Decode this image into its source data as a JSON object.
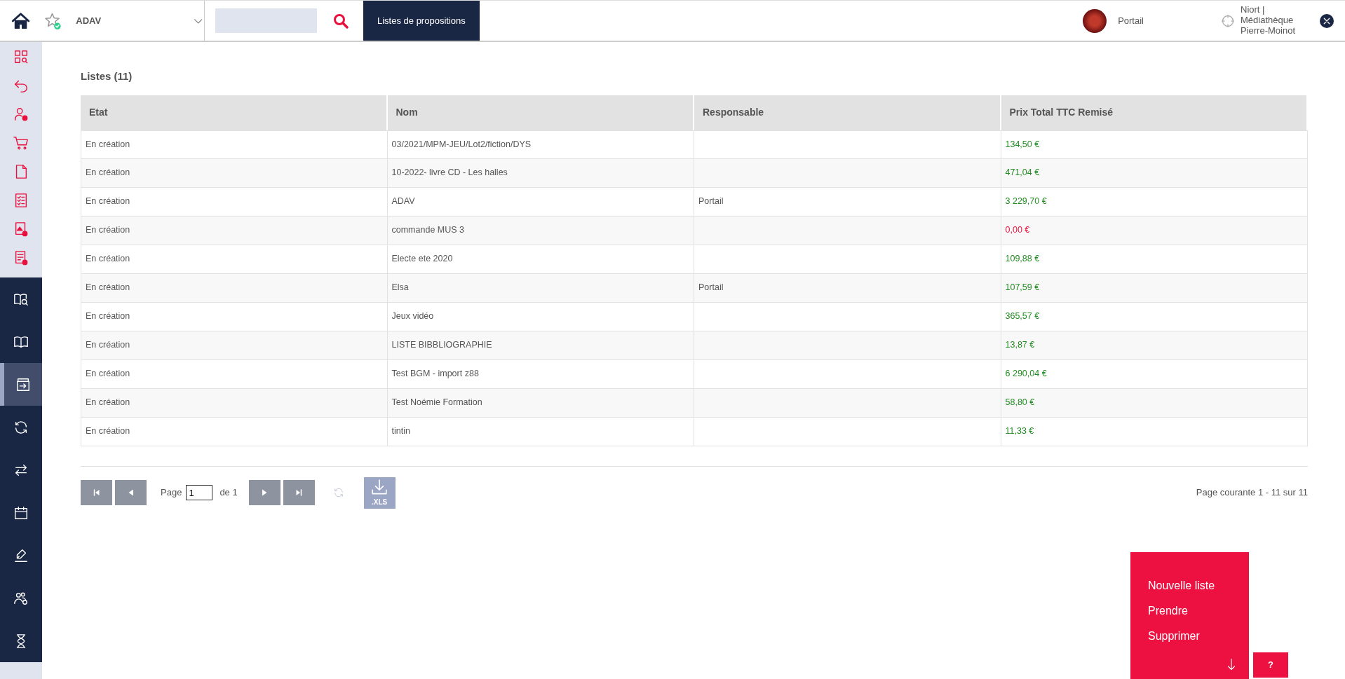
{
  "topbar": {
    "favorite": "ADAV",
    "tab": {
      "label": "Listes de propositions",
      "selected": true
    },
    "user": "Portail",
    "location": "Niort | Médiathèque Pierre-Moinot"
  },
  "sidebar": {
    "items": [
      {
        "kind": "light",
        "selected": false
      },
      {
        "kind": "light",
        "selected": false
      },
      {
        "kind": "light",
        "selected": false
      },
      {
        "kind": "light",
        "selected": false
      },
      {
        "kind": "light",
        "selected": false
      },
      {
        "kind": "light",
        "selected": false
      },
      {
        "kind": "light",
        "selected": false
      },
      {
        "kind": "light",
        "selected": false
      },
      {
        "kind": "dark",
        "selected": false
      },
      {
        "kind": "dark",
        "selected": false
      },
      {
        "kind": "dark",
        "selected": true
      },
      {
        "kind": "dark",
        "selected": false
      },
      {
        "kind": "dark",
        "selected": false
      },
      {
        "kind": "dark",
        "selected": false
      },
      {
        "kind": "dark",
        "selected": false
      },
      {
        "kind": "dark",
        "selected": false
      },
      {
        "kind": "dark",
        "selected": false
      }
    ]
  },
  "title": "Listes (11)",
  "table": {
    "columns": [
      "Etat",
      "Nom",
      "Responsable",
      "Prix Total TTC Remisé"
    ],
    "rows": [
      {
        "etat": "En création",
        "nom": "03/2021/MPM-JEU/Lot2/fiction/DYS",
        "responsable": "",
        "prix": "134,50 €",
        "color": "#218c21"
      },
      {
        "etat": "En création",
        "nom": "10-2022- livre CD - Les halles",
        "responsable": "",
        "prix": "471,04 €",
        "color": "#218c21"
      },
      {
        "etat": "En création",
        "nom": "ADAV",
        "responsable": "Portail",
        "prix": "3 229,70 €",
        "color": "#218c21"
      },
      {
        "etat": "En création",
        "nom": "commande MUS 3",
        "responsable": "",
        "prix": "0,00 €",
        "color": "#e8113d"
      },
      {
        "etat": "En création",
        "nom": "Electe ete 2020",
        "responsable": "",
        "prix": "109,88 €",
        "color": "#218c21"
      },
      {
        "etat": "En création",
        "nom": "Elsa",
        "responsable": "Portail",
        "prix": "107,59 €",
        "color": "#218c21"
      },
      {
        "etat": "En création",
        "nom": "Jeux vidéo",
        "responsable": "",
        "prix": "365,57 €",
        "color": "#218c21"
      },
      {
        "etat": "En création",
        "nom": "LISTE BIBBLIOGRAPHIE",
        "responsable": "",
        "prix": "13,87 €",
        "color": "#218c21"
      },
      {
        "etat": "En création",
        "nom": "Test BGM - import z88",
        "responsable": "",
        "prix": "6 290,04 €",
        "color": "#218c21"
      },
      {
        "etat": "En création",
        "nom": "Test Noémie Formation",
        "responsable": "",
        "prix": "58,80 €",
        "color": "#218c21"
      },
      {
        "etat": "En création",
        "nom": "tintin",
        "responsable": "",
        "prix": "11,33 €",
        "color": "#218c21"
      }
    ]
  },
  "pager": {
    "page_label": "Page",
    "page": "1",
    "of_label": "de 1",
    "export": ".XLS",
    "summary": "Page courante 1 - 11 sur 11"
  },
  "actions": [
    "Nouvelle liste",
    "Prendre",
    "Supprimer"
  ],
  "help": "?"
}
